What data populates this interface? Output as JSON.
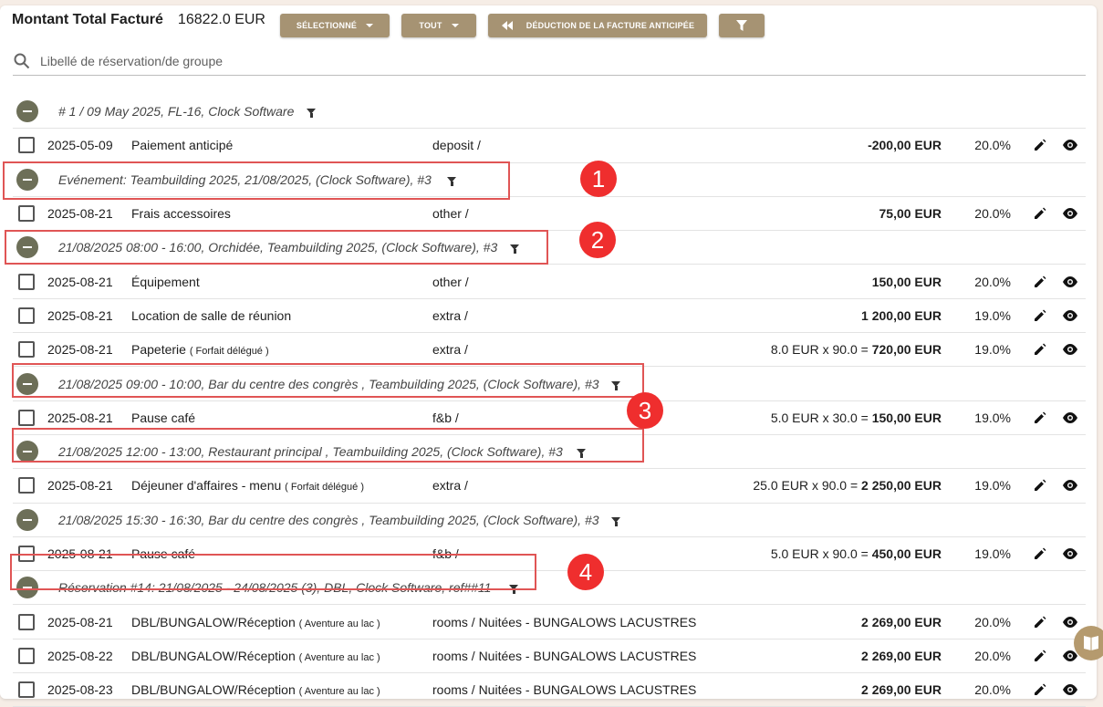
{
  "header": {
    "title": "Montant Total Facturé",
    "total": "16822.0 EUR",
    "btn_selected": "SÉLECTIONNÉ",
    "btn_all": "TOUT",
    "btn_deduction": "DÉDUCTION DE LA FACTURE ANTICIPÉE"
  },
  "search": {
    "placeholder": "Libellé de réservation/de groupe"
  },
  "groups": [
    {
      "label": "# 1 / 09 May 2025, FL-16, Clock Software"
    },
    {
      "label": "Evénement: Teambuilding 2025, 21/08/2025, (Clock Software), #3"
    },
    {
      "label": "21/08/2025 08:00 - 16:00, Orchidée, Teambuilding 2025, (Clock Software), #3"
    },
    {
      "label": "21/08/2025 09:00 - 10:00, Bar du centre des congrès , Teambuilding 2025, (Clock Software), #3"
    },
    {
      "label": "21/08/2025 12:00 - 13:00, Restaurant principal , Teambuilding 2025, (Clock Software), #3"
    },
    {
      "label": "21/08/2025 15:30 - 16:30, Bar du centre des congrès , Teambuilding 2025, (Clock Software), #3"
    },
    {
      "label": "Réservation #14: 21/08/2025 - 24/08/2025 (3), DBL, Clock Software, ref##11"
    }
  ],
  "items": [
    {
      "date": "2025-05-09",
      "label": "Paiement anticipé",
      "note": "",
      "category": "deposit /",
      "calc": "",
      "amount": "-200,00 EUR",
      "tax": "20.0%"
    },
    {
      "date": "2025-08-21",
      "label": "Frais accessoires",
      "note": "",
      "category": "other /",
      "calc": "",
      "amount": "75,00 EUR",
      "tax": "20.0%"
    },
    {
      "date": "2025-08-21",
      "label": "Équipement",
      "note": "",
      "category": "other /",
      "calc": "",
      "amount": "150,00 EUR",
      "tax": "20.0%"
    },
    {
      "date": "2025-08-21",
      "label": "Location de salle de réunion",
      "note": "",
      "category": "extra /",
      "calc": "",
      "amount": "1 200,00 EUR",
      "tax": "19.0%"
    },
    {
      "date": "2025-08-21",
      "label": "Papeterie",
      "note": "( Forfait délégué )",
      "category": "extra /",
      "calc": "8.0 EUR x 90.0 = ",
      "amount": "720,00 EUR",
      "tax": "19.0%"
    },
    {
      "date": "2025-08-21",
      "label": "Pause café",
      "note": "",
      "category": "f&b /",
      "calc": "5.0 EUR x 30.0 = ",
      "amount": "150,00 EUR",
      "tax": "19.0%"
    },
    {
      "date": "2025-08-21",
      "label": "Déjeuner d'affaires - menu",
      "note": "( Forfait délégué )",
      "category": "extra /",
      "calc": "25.0 EUR x 90.0 = ",
      "amount": "2 250,00 EUR",
      "tax": "19.0%"
    },
    {
      "date": "2025-08-21",
      "label": "Pause café",
      "note": "",
      "category": "f&b /",
      "calc": "5.0 EUR x 90.0 = ",
      "amount": "450,00 EUR",
      "tax": "19.0%"
    },
    {
      "date": "2025-08-21",
      "label": "DBL/BUNGALOW/Réception",
      "note": "( Aventure au lac )",
      "category": "rooms / Nuitées - BUNGALOWS LACUSTRES",
      "calc": "",
      "amount": "2 269,00 EUR",
      "tax": "20.0%"
    },
    {
      "date": "2025-08-22",
      "label": "DBL/BUNGALOW/Réception",
      "note": "( Aventure au lac )",
      "category": "rooms / Nuitées - BUNGALOWS LACUSTRES",
      "calc": "",
      "amount": "2 269,00 EUR",
      "tax": "20.0%"
    },
    {
      "date": "2025-08-23",
      "label": "DBL/BUNGALOW/Réception",
      "note": "( Aventure au lac )",
      "category": "rooms / Nuitées - BUNGALOWS LACUSTRES",
      "calc": "",
      "amount": "2 269,00 EUR",
      "tax": "20.0%"
    }
  ],
  "badges": [
    "1",
    "2",
    "3",
    "4"
  ],
  "colors": {
    "button": "#a69373",
    "toggle": "#6d6f58",
    "highlight": "#e05555",
    "badge": "#ef2e2e"
  }
}
